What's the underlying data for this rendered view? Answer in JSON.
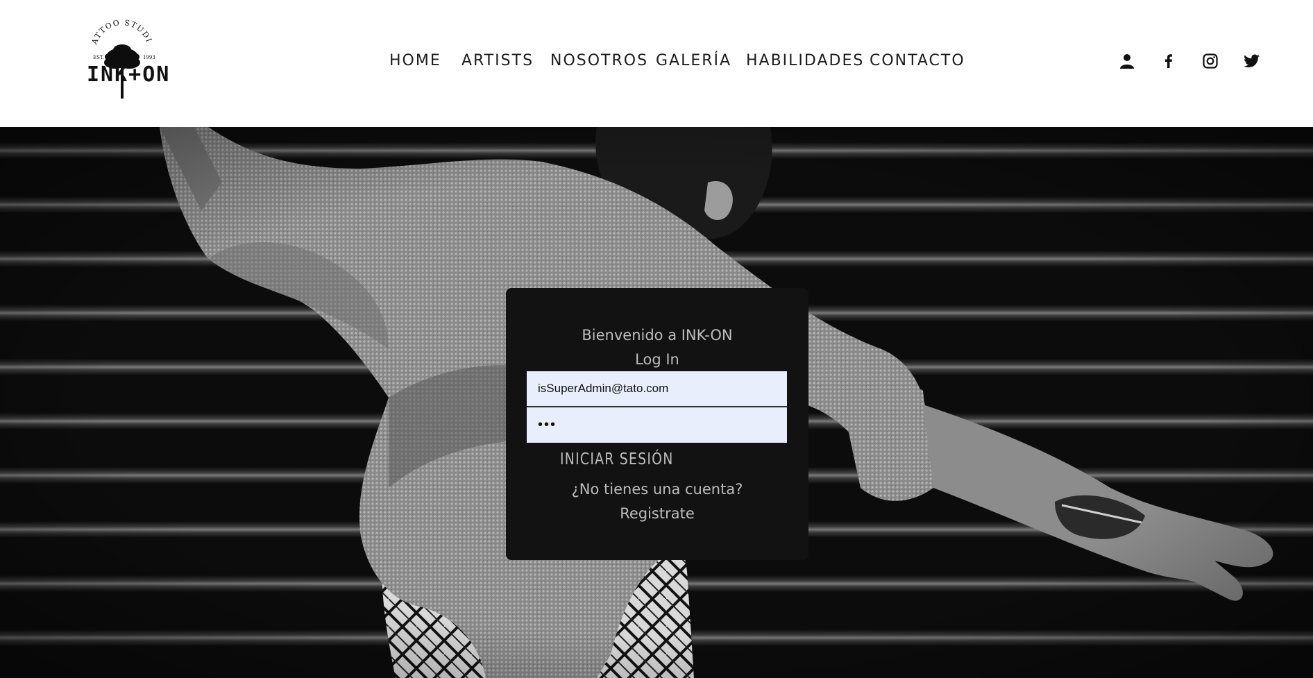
{
  "brand": {
    "logo_top_text": "TATTOO STUDIO",
    "logo_est": "EST.",
    "logo_year": "1993",
    "logo_word": "INK+ON"
  },
  "nav": {
    "items": [
      "HOME",
      "ARTISTS",
      "NOSOTROS",
      "GALERÍA",
      "HABILIDADES",
      "CONTACTO"
    ]
  },
  "social": {
    "icons": [
      "user-icon",
      "facebook-icon",
      "instagram-icon",
      "twitter-icon"
    ]
  },
  "login": {
    "welcome": "Bienvenido a INK-ON",
    "title": "Log In",
    "email_value": "isSuperAdmin@tato.com",
    "password_value": "•••",
    "submit_label": "INICIAR SESIÓN",
    "no_account_text": "¿No tienes una cuenta?",
    "register_label": "Registrate"
  },
  "colors": {
    "header_bg": "#ffffff",
    "card_bg": "#121212",
    "card_text": "#bdbdbd",
    "input_bg": "#e8eefb",
    "nav_text": "#1c1c1c"
  }
}
